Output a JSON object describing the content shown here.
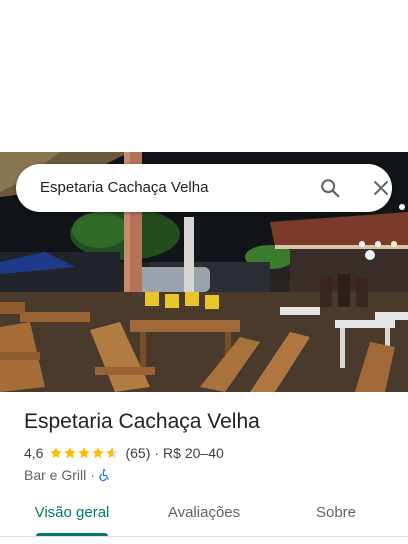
{
  "search": {
    "query": "Espetaria Cachaça Velha"
  },
  "place": {
    "name": "Espetaria Cachaça Velha",
    "rating": "4,6",
    "stars": 4.6,
    "review_count": "(65)",
    "separator": "·",
    "price_range": "R$ 20–40",
    "category": "Bar e Grill",
    "category_separator": "·",
    "accessibility_icon": "wheelchair-icon"
  },
  "tabs": [
    {
      "label": "Visão geral",
      "active": true
    },
    {
      "label": "Avaliações",
      "active": false
    },
    {
      "label": "Sobre",
      "active": false
    }
  ],
  "colors": {
    "accent": "#00796b",
    "star": "#fbbc04",
    "accessibility": "#1a73e8"
  }
}
